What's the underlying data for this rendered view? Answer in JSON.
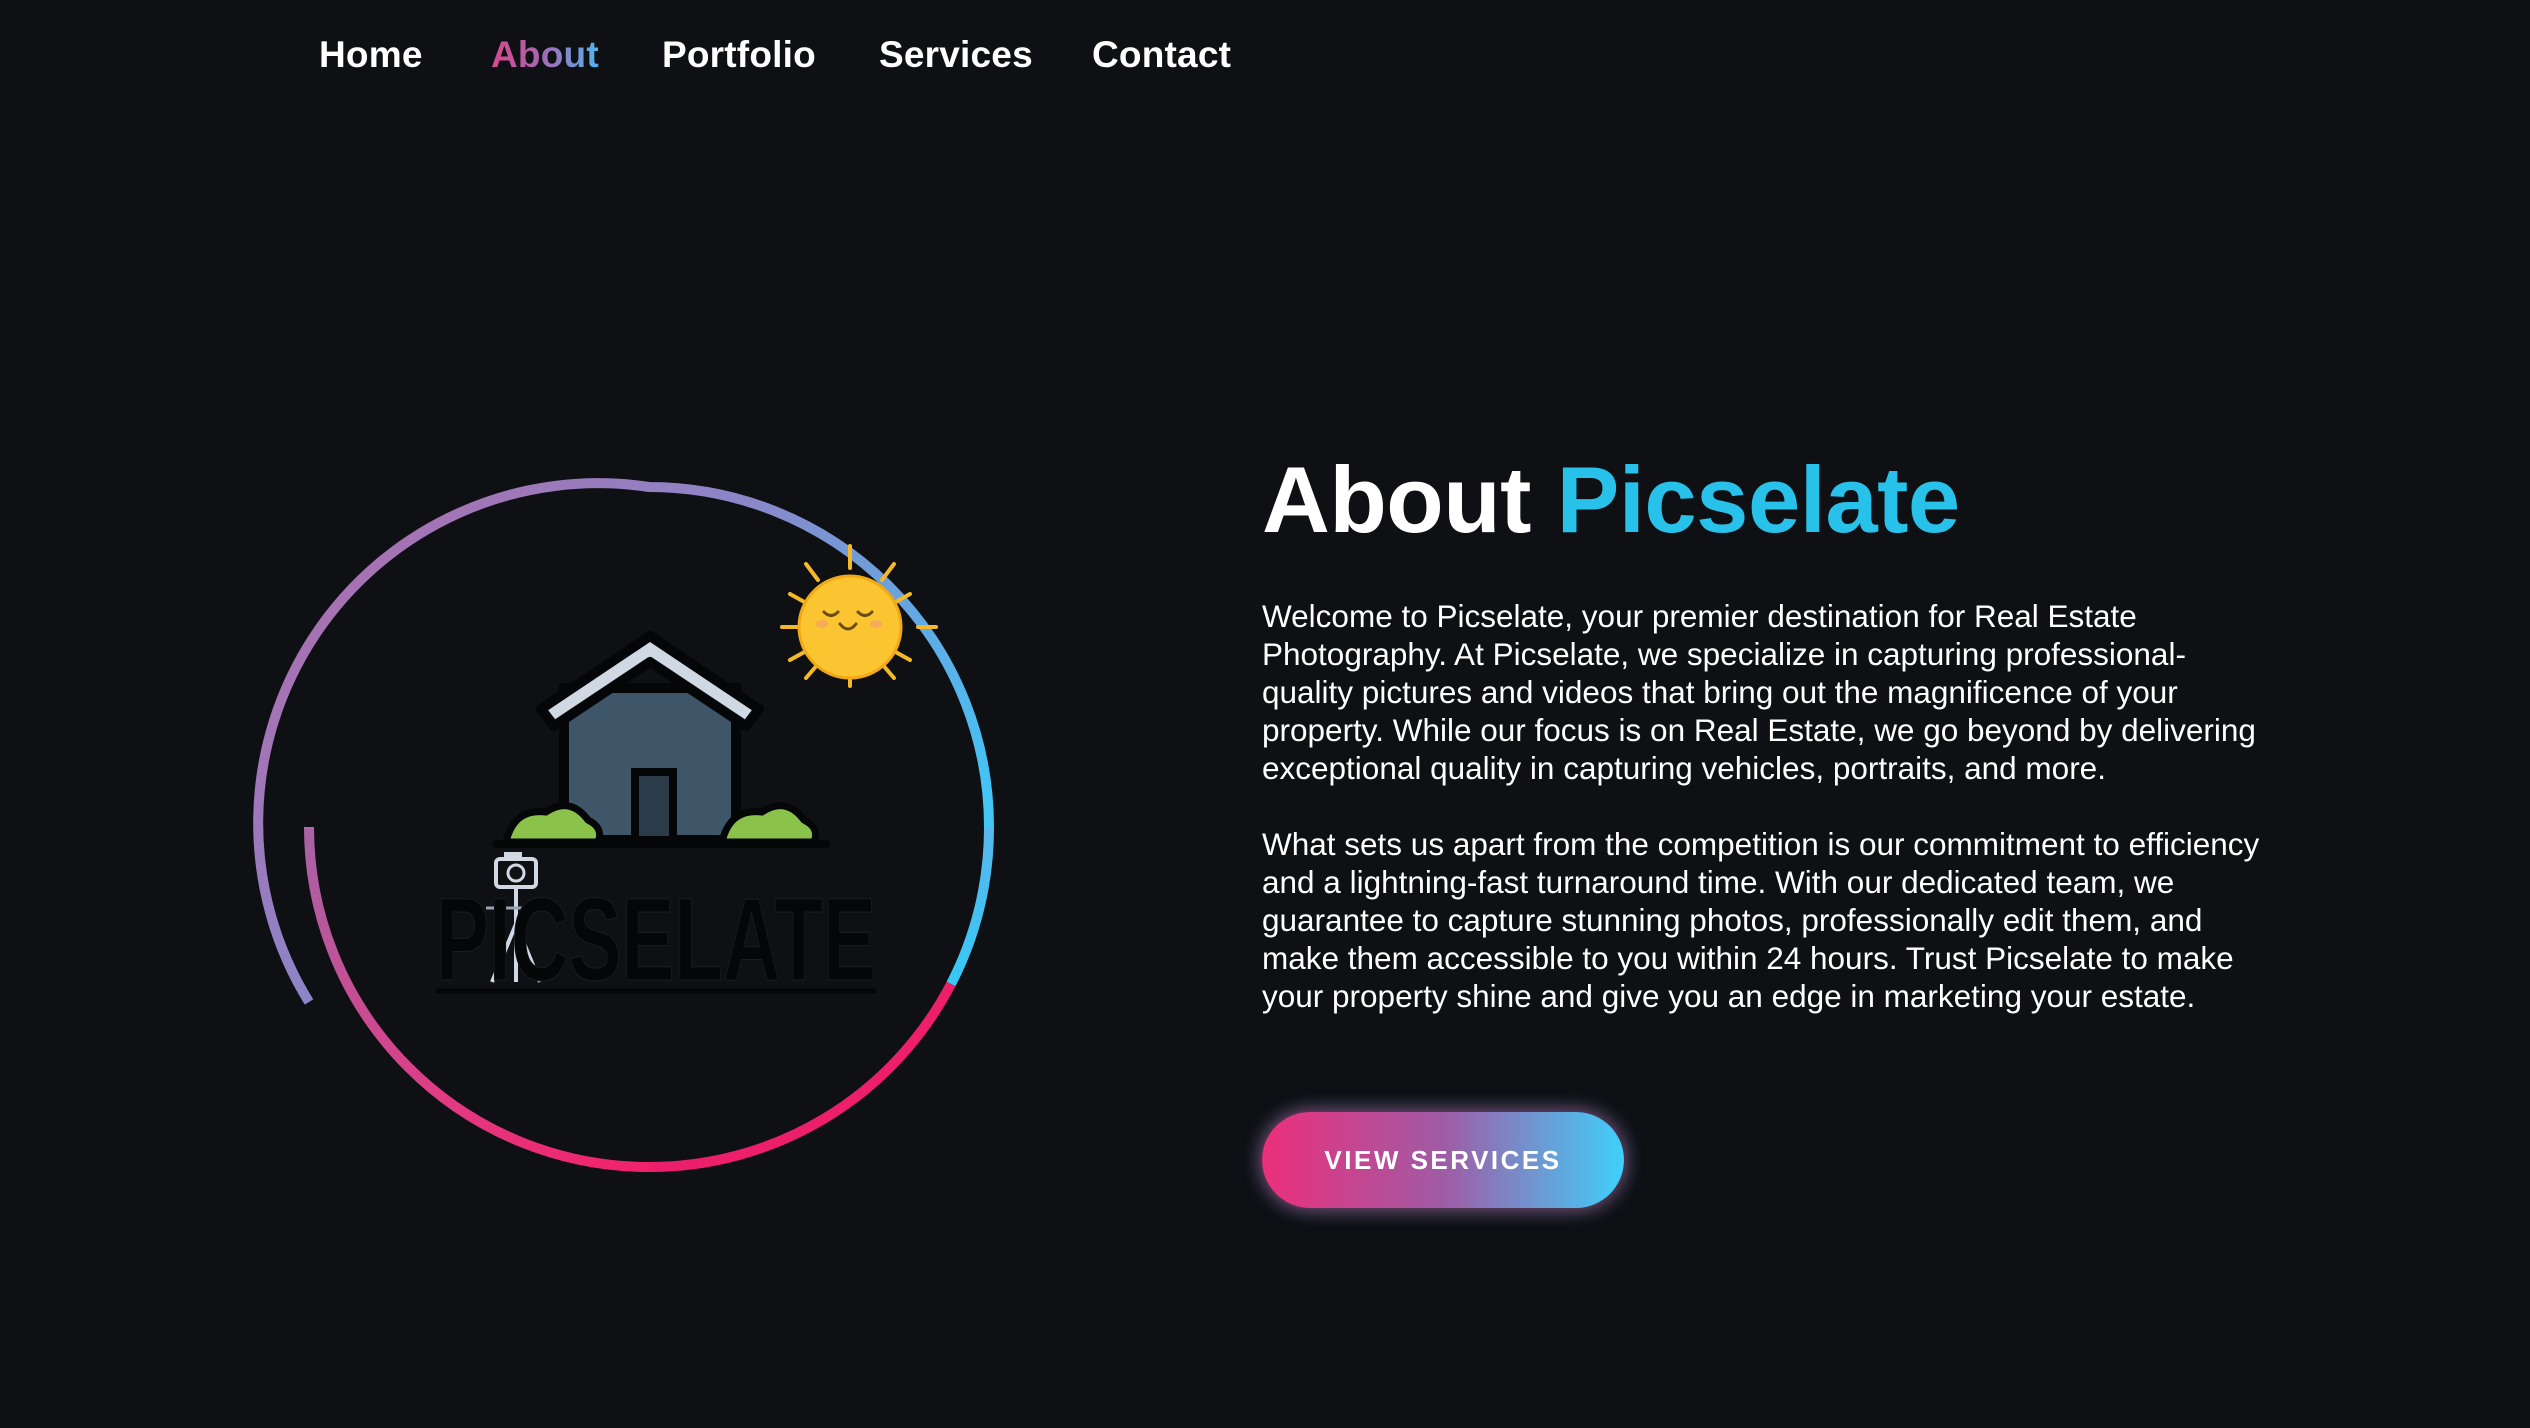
{
  "nav": {
    "items": [
      {
        "label": "Home",
        "active": false
      },
      {
        "label": "About",
        "active": true
      },
      {
        "label": "Portfolio",
        "active": false
      },
      {
        "label": "Services",
        "active": false
      },
      {
        "label": "Contact",
        "active": false
      }
    ]
  },
  "logo": {
    "wordmark": "PICSELATE",
    "icons": [
      "house-icon",
      "sun-icon",
      "camera-tripod-icon",
      "bush-icon"
    ]
  },
  "about": {
    "title_prefix": "About",
    "title_accent": "Picselate",
    "paragraphs": [
      "Welcome to Picselate, your premier destination for Real Estate Photography. At Picselate, we specialize in capturing professional-quality pictures and videos that bring out the magnificence of your property. While our focus is on Real Estate, we go beyond by delivering exceptional quality in capturing vehicles, portraits, and more.",
      "What sets us apart from the competition is our commitment to efficiency and a lightning-fast turnaround time. With our dedicated team, we guarantee to capture stunning photos, professionally edit them, and make them accessible to you within 24 hours. Trust Picselate to make your property shine and give you an edge in marketing your estate."
    ],
    "cta_label": "VIEW SERVICES"
  },
  "colors": {
    "background": "#0e1014",
    "accent_cyan": "#28c1ea",
    "accent_pink": "#ec2f7b",
    "accent_purple": "#a05ba5",
    "sun_yellow": "#fbc531",
    "house_slate": "#3f5568",
    "roof_light": "#cfd8e3",
    "bush_green": "#8bc34a"
  }
}
